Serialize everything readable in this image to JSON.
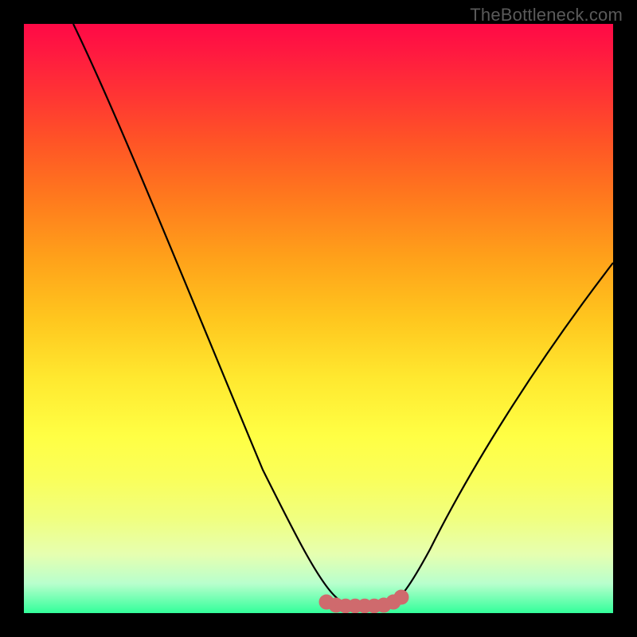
{
  "watermark": "TheBottleneck.com",
  "colors": {
    "frame": "#000000",
    "gradient_top": "#ff0946",
    "gradient_bottom": "#32ff9a",
    "curve": "#000000",
    "flat_marker": "#cf6a6d"
  },
  "chart_data": {
    "type": "line",
    "title": "",
    "xlabel": "",
    "ylabel": "",
    "xlim": [
      0,
      100
    ],
    "ylim": [
      0,
      100
    ],
    "series": [
      {
        "name": "bottleneck-curve",
        "x": [
          0,
          5,
          10,
          15,
          20,
          25,
          30,
          35,
          40,
          45,
          50,
          51,
          53,
          55,
          57,
          59,
          61,
          63,
          65,
          70,
          75,
          80,
          85,
          90,
          95,
          100
        ],
        "values": [
          100,
          90,
          80,
          70,
          60,
          50,
          41,
          32,
          23,
          14,
          6,
          4,
          2,
          1,
          0.5,
          0.5,
          0.5,
          1,
          3,
          9,
          17,
          25,
          33,
          41,
          48,
          55
        ]
      }
    ],
    "annotations": [
      {
        "name": "flat-region",
        "x_start": 51,
        "x_end": 64,
        "style": "dotted-thick",
        "color": "#cf6a6d"
      }
    ]
  }
}
